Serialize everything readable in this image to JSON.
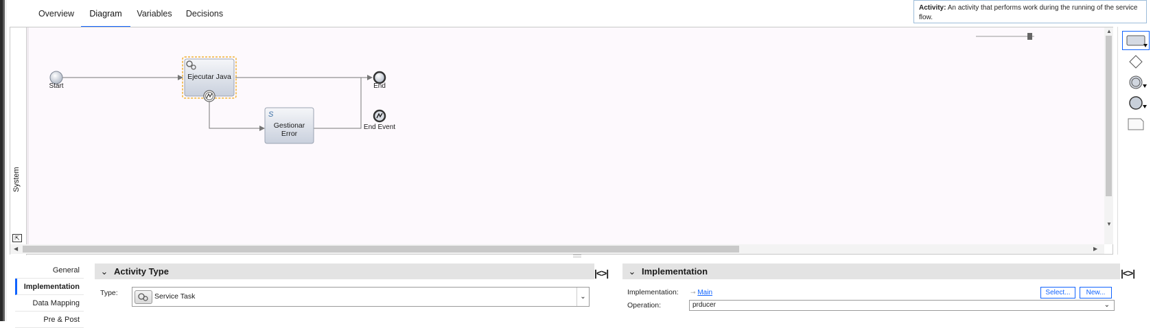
{
  "tabs": [
    {
      "label": "Overview",
      "active": false
    },
    {
      "label": "Diagram",
      "active": true
    },
    {
      "label": "Variables",
      "active": false
    },
    {
      "label": "Decisions",
      "active": false
    }
  ],
  "tooltip": {
    "title": "Activity:",
    "text": "An activity that performs work during the running of the service flow."
  },
  "lane": {
    "label": "System"
  },
  "diagram": {
    "start_label": "Start",
    "task1_label": "Ejecutar Java",
    "task2_label": "Gestionar Error",
    "end_label": "End",
    "end_event_label": "End Event"
  },
  "palette": {
    "items": [
      "activity-icon",
      "gateway-icon",
      "intermediate-event-icon",
      "end-event-icon",
      "note-icon"
    ]
  },
  "sidenav": {
    "items": [
      {
        "label": "General",
        "active": false
      },
      {
        "label": "Implementation",
        "active": true
      },
      {
        "label": "Data Mapping",
        "active": false
      },
      {
        "label": "Pre & Post",
        "active": false
      }
    ]
  },
  "activity_type": {
    "title": "Activity Type",
    "type_label": "Type:",
    "type_value": "Service Task"
  },
  "implementation": {
    "title": "Implementation",
    "impl_label": "Implementation:",
    "impl_value": "Main",
    "operation_label": "Operation:",
    "operation_value": "prducer",
    "select_button": "Select...",
    "new_button": "New..."
  },
  "colors": {
    "accent": "#0f62fe",
    "selection": "#f0b030",
    "canvas_bg": "#fdf9fd"
  }
}
